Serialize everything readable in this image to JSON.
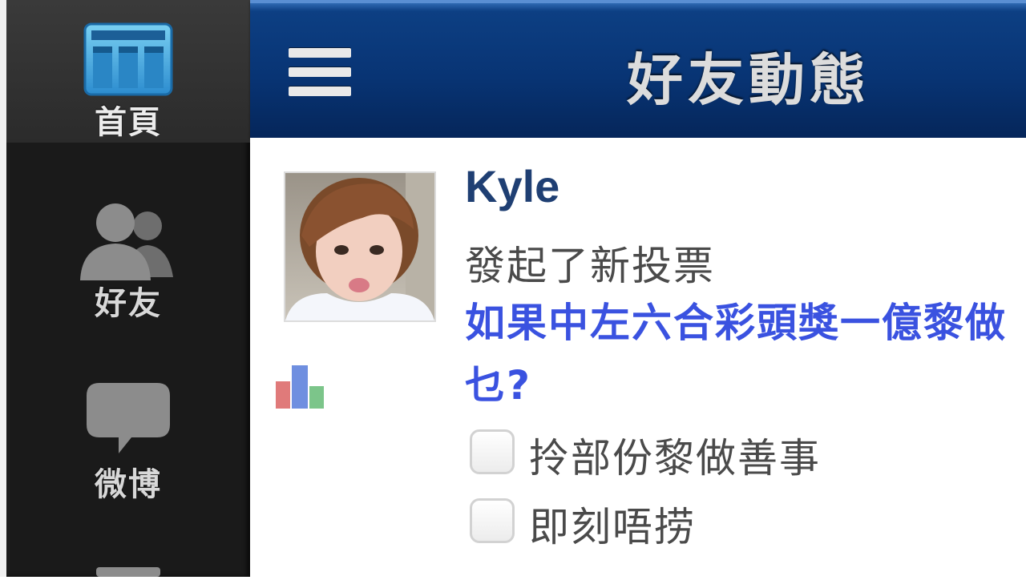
{
  "sidebar": {
    "items": [
      {
        "label": "首頁",
        "icon": "calendar-icon",
        "active": true
      },
      {
        "label": "好友",
        "icon": "friends-icon",
        "active": false
      },
      {
        "label": "微博",
        "icon": "speech-bubble-icon",
        "active": false
      }
    ]
  },
  "header": {
    "title": "好友動態",
    "menu_icon": "hamburger-menu-icon"
  },
  "feed": {
    "post": {
      "username": "Kyle",
      "action": "發起了新投票",
      "question": "如果中左六合彩頭獎一億黎做乜?",
      "post_type_icon": "poll-chart-icon",
      "options": [
        {
          "label": "拎部份黎做善事"
        },
        {
          "label": "即刻唔捞"
        }
      ]
    }
  },
  "colors": {
    "header_blue": "#083474",
    "username_blue": "#1f3f73",
    "link_blue": "#3a52e0",
    "sidebar_bg": "#1a1a1a"
  }
}
